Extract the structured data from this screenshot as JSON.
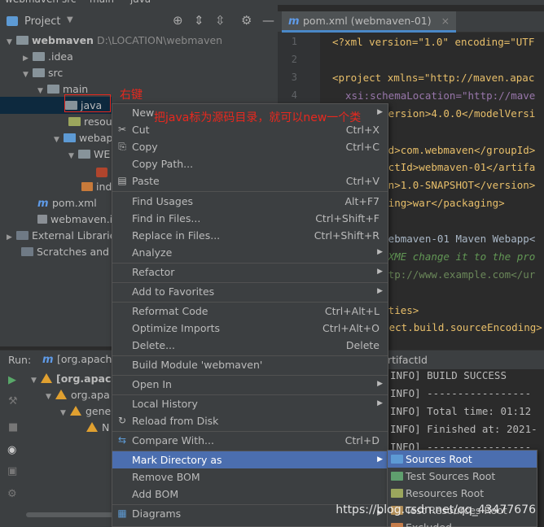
{
  "top_strip": {
    "left": "webmaven",
    "mid1": "src",
    "mid2": "main",
    "mid3": "java"
  },
  "project": {
    "title": "Project",
    "tree": [
      {
        "label": "webmaven",
        "extra": "D:\\LOCATION\\webmaven"
      },
      {
        "label": ".idea"
      },
      {
        "label": "src"
      },
      {
        "label": "main"
      },
      {
        "label": "java"
      },
      {
        "label": "resour"
      },
      {
        "label": "webap"
      },
      {
        "label": "WE"
      },
      {
        "label": "ind"
      },
      {
        "label": "pom.xml"
      },
      {
        "label": "webmaven.in"
      },
      {
        "label": "External Librarie"
      },
      {
        "label": "Scratches and C"
      }
    ]
  },
  "editor": {
    "tab_label": "pom.xml (webmaven-01)",
    "line_numbers": [
      "1",
      "2",
      "3",
      "4",
      "5"
    ],
    "lines": [
      "<?xml version=\"1.0\" encoding=\"UTF",
      "",
      "<project xmlns=\"http://maven.apac",
      "xsi:schemaLocation=\"http://mave",
      "<modelVersion>4.0.0</modelVersi",
      "",
      "<groupId>com.webmaven</groupId>",
      "<artifactId>webmaven-01</artifa",
      "<version>1.0-SNAPSHOT</version>",
      "<packaging>war</packaging>",
      "",
      "<name>webmaven-01 Maven Webapp<",
      "<!-- FIXME change it to the pro",
      "<url>http://www.example.com</ur",
      "",
      "<properties>",
      "<project.build.sourceEncoding>"
    ]
  },
  "run": {
    "label": "Run:",
    "config": "[org.apach",
    "header_right": "rtifactId",
    "tree": [
      "[org.apach",
      "org.apa",
      "gene",
      "N"
    ],
    "console": [
      "INFO] BUILD SUCCESS",
      "INFO] -----------------",
      "INFO] Total time:  01:12",
      "INFO] Finished at: 2021-",
      "INFO] -----------------"
    ]
  },
  "annotations": {
    "right_click": "右键",
    "note": "把java标为源码目录，就可以new一个类"
  },
  "context_menu": {
    "items": [
      {
        "label": "New",
        "shortcut": "",
        "submenu": true
      },
      {
        "label": "Cut",
        "shortcut": "Ctrl+X",
        "icon": "✂"
      },
      {
        "label": "Copy",
        "shortcut": "Ctrl+C",
        "icon": "⎘"
      },
      {
        "label": "Copy Path...",
        "shortcut": ""
      },
      {
        "label": "Paste",
        "shortcut": "Ctrl+V",
        "icon": "📋"
      },
      {
        "label": "Find Usages",
        "shortcut": "Alt+F7"
      },
      {
        "label": "Find in Files...",
        "shortcut": "Ctrl+Shift+F"
      },
      {
        "label": "Replace in Files...",
        "shortcut": "Ctrl+Shift+R"
      },
      {
        "label": "Analyze",
        "shortcut": "",
        "submenu": true
      },
      {
        "label": "Refactor",
        "shortcut": "",
        "submenu": true
      },
      {
        "label": "Add to Favorites",
        "shortcut": "",
        "submenu": true
      },
      {
        "label": "Reformat Code",
        "shortcut": "Ctrl+Alt+L"
      },
      {
        "label": "Optimize Imports",
        "shortcut": "Ctrl+Alt+O"
      },
      {
        "label": "Delete...",
        "shortcut": "Delete"
      },
      {
        "label": "Build Module 'webmaven'",
        "shortcut": ""
      },
      {
        "label": "Open In",
        "shortcut": "",
        "submenu": true
      },
      {
        "label": "Local History",
        "shortcut": "",
        "submenu": true
      },
      {
        "label": "Reload from Disk",
        "shortcut": "",
        "icon": "↻"
      },
      {
        "label": "Compare With...",
        "shortcut": "Ctrl+D",
        "icon": "⇆"
      },
      {
        "label": "Mark Directory as",
        "shortcut": "",
        "submenu": true
      },
      {
        "label": "Remove BOM",
        "shortcut": ""
      },
      {
        "label": "Add BOM",
        "shortcut": ""
      },
      {
        "label": "Diagrams",
        "shortcut": "",
        "submenu": true,
        "icon": "▦"
      }
    ]
  },
  "sub_menu": {
    "items": [
      {
        "label": "Sources Root",
        "color": "#5d9ad4"
      },
      {
        "label": "Test Sources Root",
        "color": "#5f9f6e"
      },
      {
        "label": "Resources Root",
        "color": "#9ba65d"
      },
      {
        "label": "Test Resources Root",
        "color": "#b08d57"
      },
      {
        "label": "Excluded",
        "color": "#c57c4a"
      }
    ]
  },
  "watermark": "https://blog.csdn.net/qq_43477676"
}
